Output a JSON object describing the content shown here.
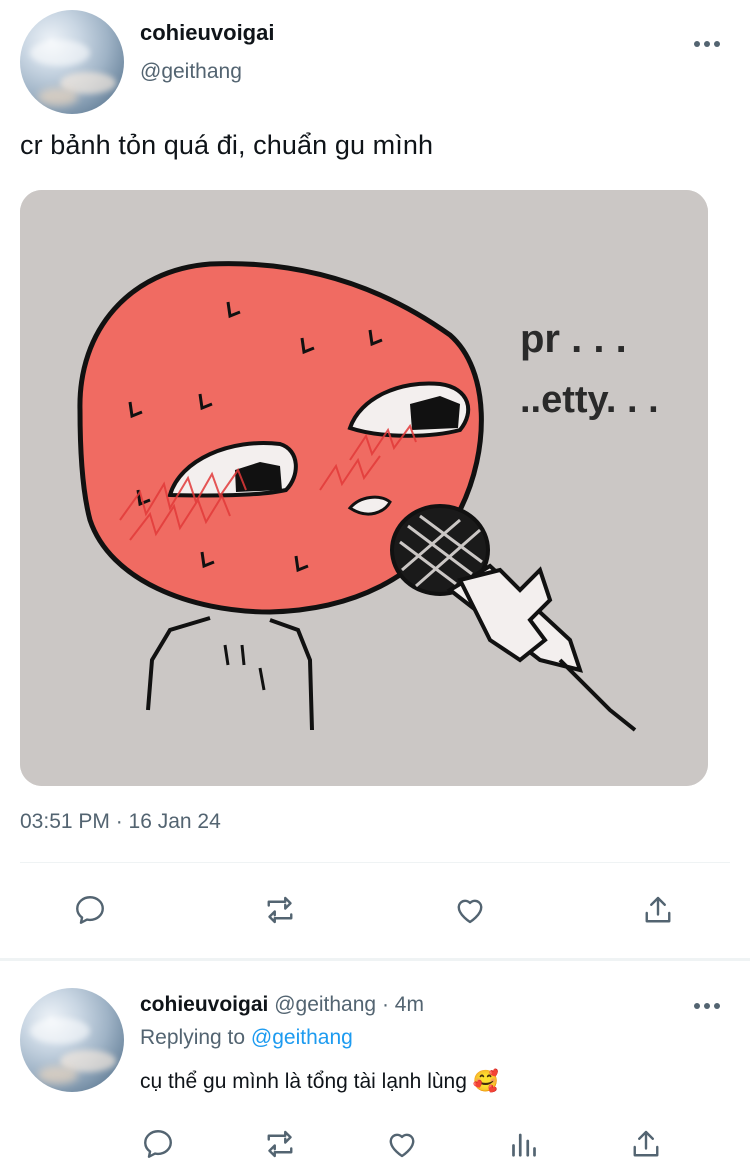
{
  "tweet": {
    "author_name": "cohieuvoigai",
    "author_handle": "@geithang",
    "text": "cr bảnh tỏn quá đi, chuẩn gu mình",
    "media": {
      "caption_line1": "pr . . .",
      "caption_line2": "..etty. . ."
    },
    "timestamp": "03:51 PM · 16 Jan 24"
  },
  "reply": {
    "author_name": "cohieuvoigai",
    "author_handle": "@geithang",
    "separator": " · ",
    "age": "4m",
    "replying_prefix": "Replying to",
    "replying_mention": "@geithang",
    "text": "cụ thể gu mình là tổng tài lạnh lùng 🥰"
  },
  "icons": {
    "more": "more-horizontal-icon",
    "reply": "reply-icon",
    "retweet": "retweet-icon",
    "like": "heart-icon",
    "share": "share-icon",
    "analytics": "analytics-icon"
  },
  "colors": {
    "text_primary": "#0f1419",
    "text_secondary": "#536471",
    "accent": "#1d9bf0",
    "divider": "#eff3f4",
    "meme_face": "#f06b62"
  }
}
